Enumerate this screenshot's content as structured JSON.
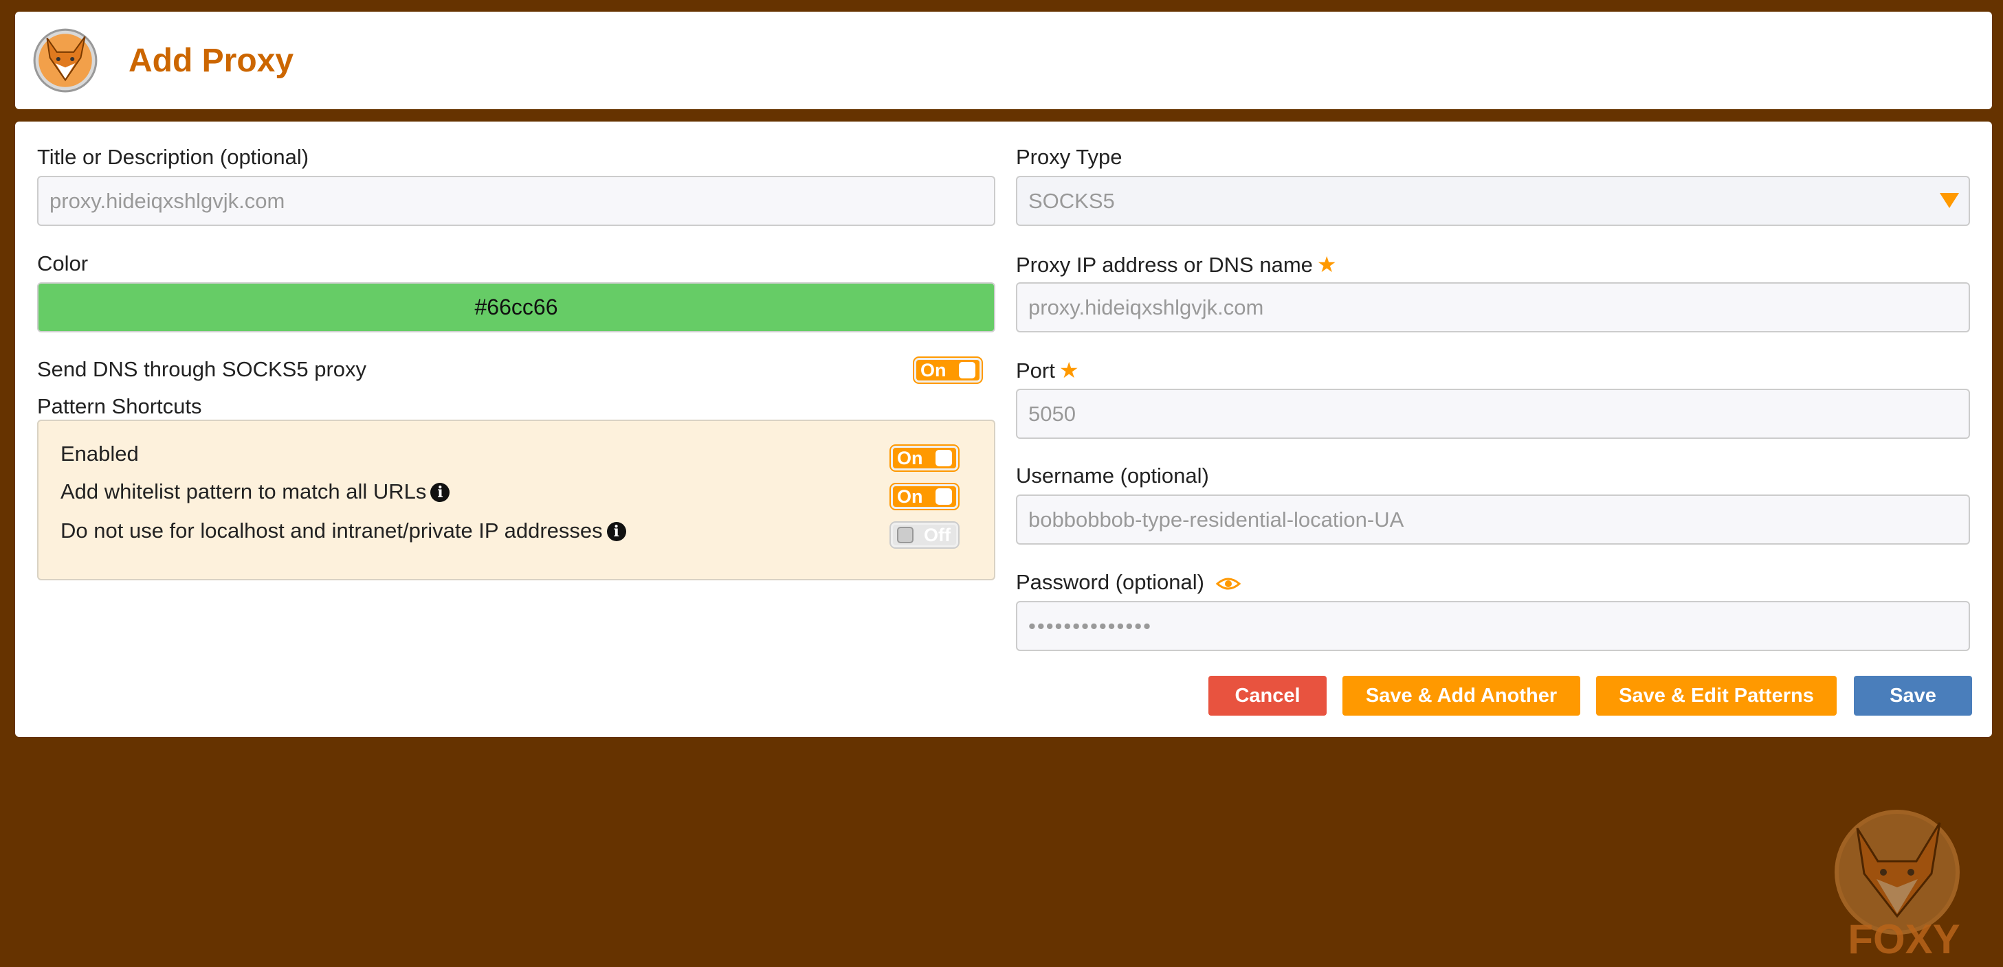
{
  "header": {
    "title": "Add Proxy"
  },
  "form_left": {
    "title_label": "Title or Description (optional)",
    "title_value": "proxy.hideiqxshlgvjk.com",
    "color_label": "Color",
    "color_value": "#66cc66",
    "dns_label": "Send DNS through SOCKS5 proxy",
    "dns_toggle": "On",
    "pattern_shortcuts_label": "Pattern Shortcuts",
    "shortcuts": [
      {
        "label": "Enabled",
        "toggle": "On"
      },
      {
        "label": "Add whitelist pattern to match all URLs",
        "toggle": "On"
      },
      {
        "label": "Do not use for localhost and intranet/private IP addresses",
        "toggle": "Off"
      }
    ]
  },
  "form_right": {
    "proxy_type_label": "Proxy Type",
    "proxy_type_value": "SOCKS5",
    "ip_label": "Proxy IP address or DNS name",
    "ip_value": "proxy.hideiqxshlgvjk.com",
    "port_label": "Port",
    "port_value": "5050",
    "username_label": "Username (optional)",
    "username_value": "bobbobbob-type-residential-location-UA",
    "password_label": "Password (optional)",
    "password_value": "••••••••••••••"
  },
  "buttons": {
    "cancel": "Cancel",
    "save_add_another": "Save & Add Another",
    "save_edit_patterns": "Save & Edit Patterns",
    "save": "Save"
  },
  "background_logo_text": "FOXY",
  "colors": {
    "background": "#663300",
    "accent": "#ff9900",
    "title": "#cc6600",
    "cancel": "#e8533f",
    "save": "#4a7ebb",
    "color_swatch": "#66cc66"
  }
}
